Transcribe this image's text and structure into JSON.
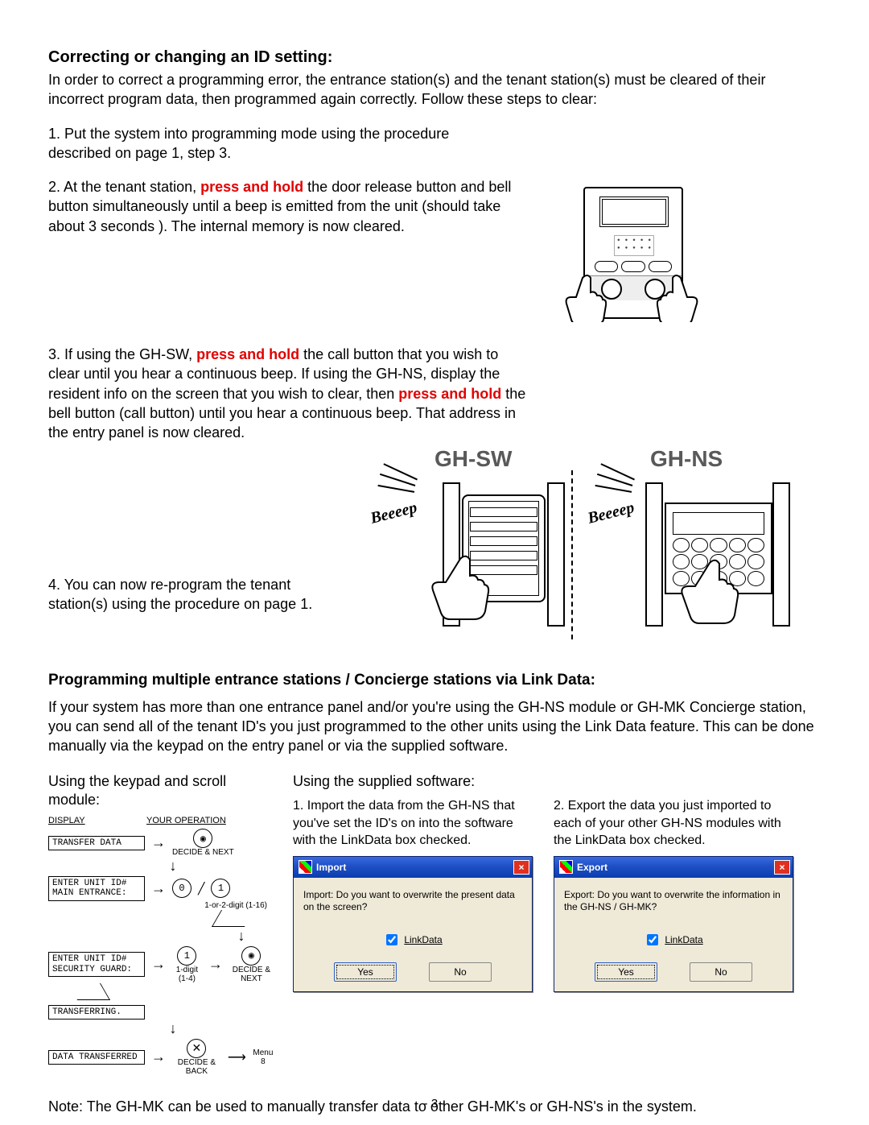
{
  "section1": {
    "heading": "Correcting or changing an ID setting:",
    "intro": "In order to correct a programming error, the entrance station(s) and the tenant station(s) must be cleared of their incorrect program data, then programmed again correctly. Follow these steps to clear:",
    "step1": "1. Put the system into programming mode using the procedure described on page 1, step 3.",
    "step2_a": "2. At the tenant station, ",
    "step2_red": "press and hold",
    "step2_b": " the door release button and bell button simultaneously until a beep is emitted from the unit (should take about 3 seconds ).  The internal memory is now cleared.",
    "step3_a": "3. If using the GH-SW, ",
    "step3_red1": "press and hold",
    "step3_b": " the call button that you wish to clear until you hear a continuous beep.  If using the GH-NS, display the resident info on the screen that you wish to clear, then ",
    "step3_red2": "press and hold",
    "step3_c": " the bell button (call button) until you hear a continuous beep. That address in the entry panel is now cleared.",
    "step4": "4. You can now re-program the tenant station(s) using the procedure on page 1.",
    "ghsw": "GH-SW",
    "ghns": "GH-NS",
    "beeeep": "Beeeep"
  },
  "section2": {
    "heading": "Programming multiple entrance stations / Concierge stations via Link Data:",
    "intro": "If your system has more than one entrance panel and/or you're using the GH-NS module or GH-MK Concierge station, you can send all of the tenant ID's you just programmed to the other units using the Link Data feature.  This can be done manually via the keypad on the entry panel or via the supplied software.",
    "colA_head": "Using the keypad and scroll module:",
    "colBC_head": "Using the supplied software:",
    "colB_text": "1. Import the data from the GH-NS that you've set the ID's on into the software with the LinkData box checked.",
    "colC_text": "2. Export the data you just imported to each of your other GH-NS modules with the LinkData box checked.",
    "note": "Note:  The GH-MK can be used to manually transfer data to other GH-MK's or GH-NS's in the system."
  },
  "flow": {
    "display": "DISPLAY",
    "your_op": "YOUR OPERATION",
    "box1": "TRANSFER DATA",
    "op1": "DECIDE & NEXT",
    "box2": "ENTER UNIT ID#\nMAIN ENTRANCE:",
    "op2a": "0",
    "op2b": "1",
    "op2_label": "1-or-2-digit (1-16)",
    "box3": "ENTER UNIT ID#\nSECURITY GUARD:",
    "op3a": "1",
    "op3_label1": "1-digit (1-4)",
    "op3_label2": "DECIDE & NEXT",
    "box4": "TRANSFERRING.",
    "box5": "DATA TRANSFERRED",
    "op5": "DECIDE & BACK",
    "menu8": "Menu 8"
  },
  "dlg_import": {
    "title": "Import",
    "msg": "Import: Do you want to overwrite the present data on the screen?",
    "check": "LinkData",
    "yes": "Yes",
    "no": "No"
  },
  "dlg_export": {
    "title": "Export",
    "msg": "Export: Do you want to overwrite the information in the GH-NS / GH-MK?",
    "check": "LinkData",
    "yes": "Yes",
    "no": "No"
  },
  "pagenum": "- 3 -"
}
